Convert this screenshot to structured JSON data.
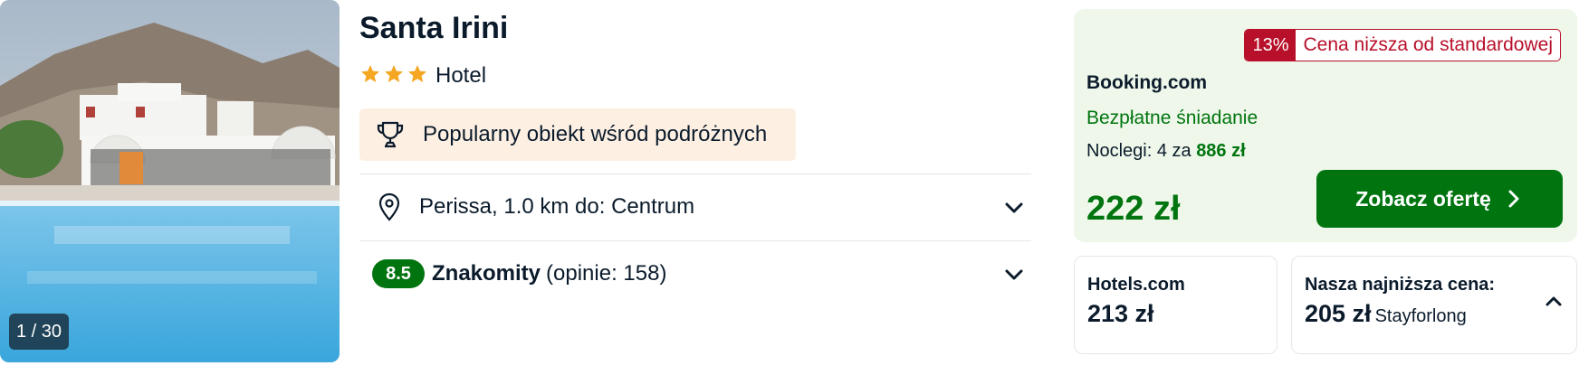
{
  "photo": {
    "counter": "1 / 30",
    "alt": "hotel photo"
  },
  "hotel": {
    "name": "Santa Irini",
    "stars": 3,
    "type": "Hotel",
    "popular_badge": "Popularny obiekt wśród podróżnych",
    "location": "Perissa, 1.0 km do: Centrum",
    "rating": {
      "score": "8.5",
      "label": "Znakomity",
      "reviews": "(opinie: 158)"
    }
  },
  "deal": {
    "discount_pct": "13%",
    "discount_label": "Cena niższa od standardowej",
    "provider": "Booking.com",
    "perk": "Bezpłatne śniadanie",
    "nights_label": "Noclegi: 4 za",
    "nights_total": "886 zł",
    "price": "222 zł",
    "cta_label": "Zobacz ofertę"
  },
  "other_offers": [
    {
      "provider": "Hotels.com",
      "price": "213 zł"
    },
    {
      "label": "Nasza najniższa cena:",
      "price": "205 zł",
      "provider": "Stayforlong"
    }
  ],
  "colors": {
    "accent_green": "#00750f",
    "deal_bg": "#eef7ea",
    "discount_red": "#b8102a",
    "star_gold": "#f5a623",
    "popular_bg": "#fdf0e3"
  },
  "icons": [
    "star-icon",
    "trophy-icon",
    "location-pin-icon",
    "chevron-down-icon",
    "chevron-right-icon",
    "chevron-up-icon"
  ]
}
